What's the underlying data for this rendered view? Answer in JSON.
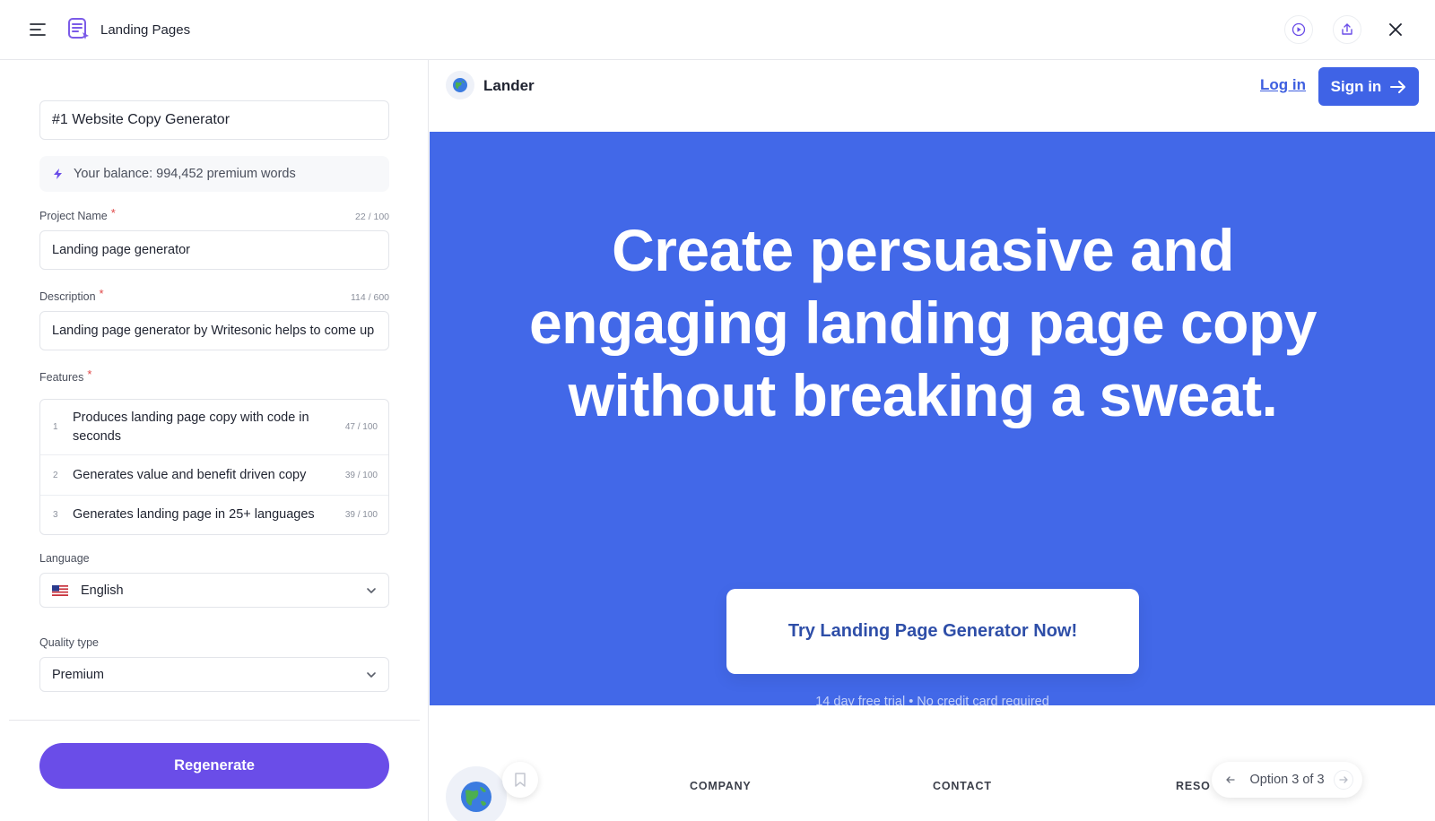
{
  "header": {
    "title": "Landing Pages",
    "icons": {
      "menu": "hamburger-icon",
      "app": "document-icon",
      "play": "play-icon",
      "share": "share-icon",
      "close": "close-icon"
    }
  },
  "form": {
    "tool_name": "#1 Website Copy Generator",
    "balance": "Your balance: 994,452 premium words",
    "project_name": {
      "label": "Project Name",
      "required": "*",
      "counter": "22 / 100",
      "value": "Landing page generator"
    },
    "description": {
      "label": "Description",
      "required": "*",
      "counter": "114 / 600",
      "value": "Landing page generator by Writesonic helps to come up"
    },
    "features": {
      "label": "Features",
      "required": "*",
      "items": [
        {
          "num": "1",
          "text": "Produces landing page copy with code in seconds",
          "counter": "47 / 100"
        },
        {
          "num": "2",
          "text": "Generates value and benefit driven copy",
          "counter": "39 / 100"
        },
        {
          "num": "3",
          "text": "Generates landing page in 25+ languages",
          "counter": "39 / 100"
        }
      ]
    },
    "language": {
      "label": "Language",
      "value": "English"
    },
    "quality": {
      "label": "Quality type",
      "value": "Premium"
    },
    "regenerate_label": "Regenerate"
  },
  "preview": {
    "brand": "Lander",
    "login": "Log in",
    "signin": "Sign in",
    "hero_title": "Create persuasive and engaging landing page copy without breaking a sweat.",
    "cta": "Try Landing Page Generator Now!",
    "trial": "14 day free trial • No credit card required",
    "footer_cols": [
      "COMPANY",
      "CONTACT",
      "RESO"
    ],
    "option": "Option 3 of 3"
  },
  "colors": {
    "accent": "#6a4de8",
    "hero": "#4268e8",
    "link": "#3e5fe0"
  }
}
